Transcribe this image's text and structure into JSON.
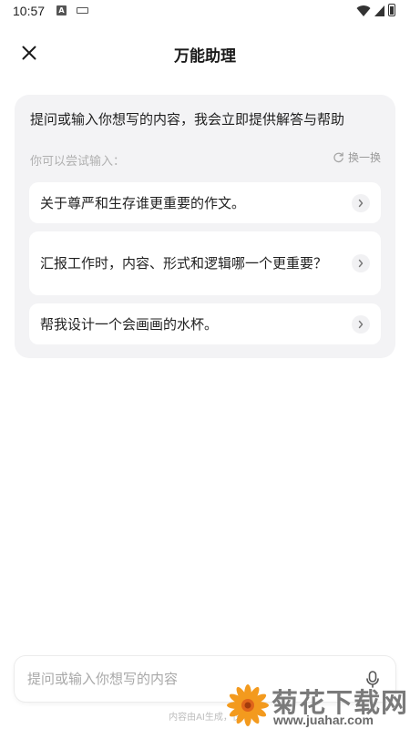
{
  "status_bar": {
    "time": "10:57",
    "app_icon_letter": "A"
  },
  "header": {
    "title": "万能助理",
    "close_icon": "close-icon"
  },
  "panel": {
    "intro": "提问或输入你想写的内容，我会立即提供解答与帮助",
    "hint": "你可以尝试输入：",
    "refresh_label": "换一换",
    "suggestions": [
      {
        "text": "关于尊严和生存谁更重要的作文。"
      },
      {
        "text": "汇报工作时，内容、形式和逻辑哪一个更重要？"
      },
      {
        "text": "帮我设计一个会画画的水杯。"
      }
    ]
  },
  "input": {
    "placeholder": "提问或输入你想写的内容",
    "value": ""
  },
  "footer": {
    "disclaimer": "内容由AI生成，仅"
  },
  "watermark": {
    "title": "菊花下载网",
    "url": "www.juahar.com"
  },
  "colors": {
    "panel_bg": "#f3f3f5",
    "card_bg": "#ffffff",
    "hint": "#b0b0b0",
    "watermark_orange": "#f39a1e"
  }
}
